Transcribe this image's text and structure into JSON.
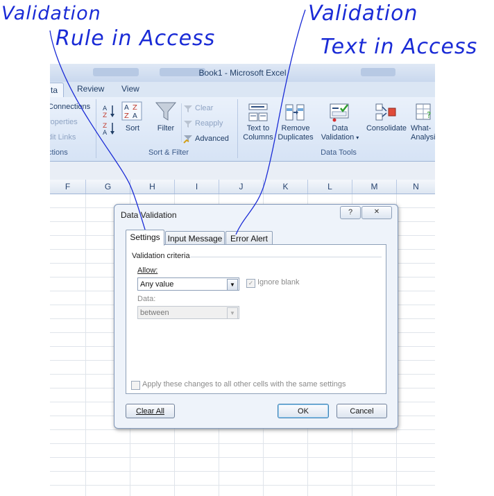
{
  "annotations": {
    "left_line1": "Validation",
    "left_line2": "Rule in Access",
    "right_line1": "Validation",
    "right_line2": "Text in Access"
  },
  "excel": {
    "window_title": "Book1 - Microsoft Excel",
    "ribbon_tabs": [
      "ta",
      "Review",
      "View"
    ],
    "connections_group": {
      "items": [
        "Connections",
        "roperties",
        "dit Links"
      ],
      "label": "ctions"
    },
    "sort_filter": {
      "sort_label": "Sort",
      "filter_label": "Filter",
      "clear_label": "Clear",
      "reapply_label": "Reapply",
      "advanced_label": "Advanced",
      "group_label": "Sort & Filter"
    },
    "data_tools": {
      "text_to_columns": [
        "Text to",
        "Columns"
      ],
      "remove_duplicates": [
        "Remove",
        "Duplicates"
      ],
      "data_validation": [
        "Data",
        "Validation"
      ],
      "consolidate": "Consolidate",
      "what_if": [
        "What-",
        "Analysi"
      ],
      "group_label": "Data Tools"
    },
    "columns": [
      "F",
      "G",
      "H",
      "I",
      "J",
      "K",
      "L",
      "M",
      "N"
    ]
  },
  "dialog": {
    "title": "Data Validation",
    "help_button": "?",
    "close_button": "✕",
    "tabs": [
      "Settings",
      "Input Message",
      "Error Alert"
    ],
    "active_tab": "Settings",
    "validation_criteria": "Validation criteria",
    "allow_label": "Allow:",
    "allow_value": "Any value",
    "ignore_blank_label": "Ignore blank",
    "ignore_blank_checked": true,
    "data_label": "Data:",
    "data_value": "between",
    "apply_label": "Apply these changes to all other cells with the same settings",
    "clear_all": "Clear All",
    "ok": "OK",
    "cancel": "Cancel"
  },
  "colors": {
    "annotation_ink": "#1a2bd6",
    "ribbon_text": "#1f3d66"
  }
}
